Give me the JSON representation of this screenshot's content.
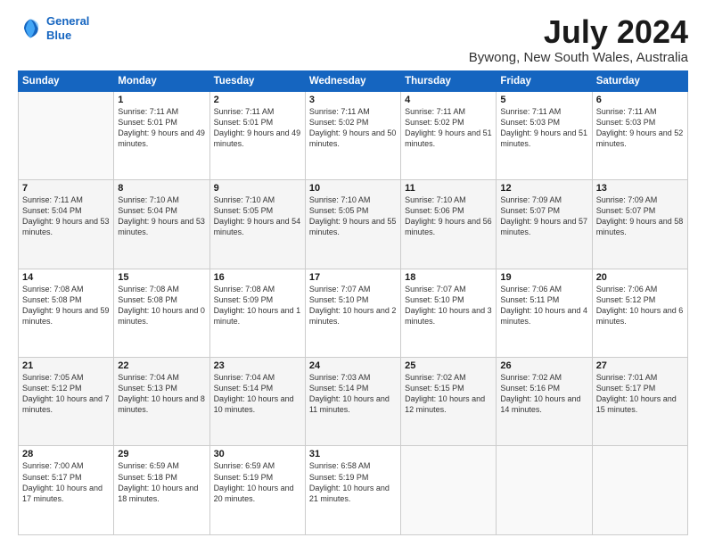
{
  "logo": {
    "line1": "General",
    "line2": "Blue"
  },
  "title": "July 2024",
  "subtitle": "Bywong, New South Wales, Australia",
  "days_of_week": [
    "Sunday",
    "Monday",
    "Tuesday",
    "Wednesday",
    "Thursday",
    "Friday",
    "Saturday"
  ],
  "weeks": [
    [
      {
        "day": "",
        "sunrise": "",
        "sunset": "",
        "daylight": ""
      },
      {
        "day": "1",
        "sunrise": "Sunrise: 7:11 AM",
        "sunset": "Sunset: 5:01 PM",
        "daylight": "Daylight: 9 hours and 49 minutes."
      },
      {
        "day": "2",
        "sunrise": "Sunrise: 7:11 AM",
        "sunset": "Sunset: 5:01 PM",
        "daylight": "Daylight: 9 hours and 49 minutes."
      },
      {
        "day": "3",
        "sunrise": "Sunrise: 7:11 AM",
        "sunset": "Sunset: 5:02 PM",
        "daylight": "Daylight: 9 hours and 50 minutes."
      },
      {
        "day": "4",
        "sunrise": "Sunrise: 7:11 AM",
        "sunset": "Sunset: 5:02 PM",
        "daylight": "Daylight: 9 hours and 51 minutes."
      },
      {
        "day": "5",
        "sunrise": "Sunrise: 7:11 AM",
        "sunset": "Sunset: 5:03 PM",
        "daylight": "Daylight: 9 hours and 51 minutes."
      },
      {
        "day": "6",
        "sunrise": "Sunrise: 7:11 AM",
        "sunset": "Sunset: 5:03 PM",
        "daylight": "Daylight: 9 hours and 52 minutes."
      }
    ],
    [
      {
        "day": "7",
        "sunrise": "Sunrise: 7:11 AM",
        "sunset": "Sunset: 5:04 PM",
        "daylight": "Daylight: 9 hours and 53 minutes."
      },
      {
        "day": "8",
        "sunrise": "Sunrise: 7:10 AM",
        "sunset": "Sunset: 5:04 PM",
        "daylight": "Daylight: 9 hours and 53 minutes."
      },
      {
        "day": "9",
        "sunrise": "Sunrise: 7:10 AM",
        "sunset": "Sunset: 5:05 PM",
        "daylight": "Daylight: 9 hours and 54 minutes."
      },
      {
        "day": "10",
        "sunrise": "Sunrise: 7:10 AM",
        "sunset": "Sunset: 5:05 PM",
        "daylight": "Daylight: 9 hours and 55 minutes."
      },
      {
        "day": "11",
        "sunrise": "Sunrise: 7:10 AM",
        "sunset": "Sunset: 5:06 PM",
        "daylight": "Daylight: 9 hours and 56 minutes."
      },
      {
        "day": "12",
        "sunrise": "Sunrise: 7:09 AM",
        "sunset": "Sunset: 5:07 PM",
        "daylight": "Daylight: 9 hours and 57 minutes."
      },
      {
        "day": "13",
        "sunrise": "Sunrise: 7:09 AM",
        "sunset": "Sunset: 5:07 PM",
        "daylight": "Daylight: 9 hours and 58 minutes."
      }
    ],
    [
      {
        "day": "14",
        "sunrise": "Sunrise: 7:08 AM",
        "sunset": "Sunset: 5:08 PM",
        "daylight": "Daylight: 9 hours and 59 minutes."
      },
      {
        "day": "15",
        "sunrise": "Sunrise: 7:08 AM",
        "sunset": "Sunset: 5:08 PM",
        "daylight": "Daylight: 10 hours and 0 minutes."
      },
      {
        "day": "16",
        "sunrise": "Sunrise: 7:08 AM",
        "sunset": "Sunset: 5:09 PM",
        "daylight": "Daylight: 10 hours and 1 minute."
      },
      {
        "day": "17",
        "sunrise": "Sunrise: 7:07 AM",
        "sunset": "Sunset: 5:10 PM",
        "daylight": "Daylight: 10 hours and 2 minutes."
      },
      {
        "day": "18",
        "sunrise": "Sunrise: 7:07 AM",
        "sunset": "Sunset: 5:10 PM",
        "daylight": "Daylight: 10 hours and 3 minutes."
      },
      {
        "day": "19",
        "sunrise": "Sunrise: 7:06 AM",
        "sunset": "Sunset: 5:11 PM",
        "daylight": "Daylight: 10 hours and 4 minutes."
      },
      {
        "day": "20",
        "sunrise": "Sunrise: 7:06 AM",
        "sunset": "Sunset: 5:12 PM",
        "daylight": "Daylight: 10 hours and 6 minutes."
      }
    ],
    [
      {
        "day": "21",
        "sunrise": "Sunrise: 7:05 AM",
        "sunset": "Sunset: 5:12 PM",
        "daylight": "Daylight: 10 hours and 7 minutes."
      },
      {
        "day": "22",
        "sunrise": "Sunrise: 7:04 AM",
        "sunset": "Sunset: 5:13 PM",
        "daylight": "Daylight: 10 hours and 8 minutes."
      },
      {
        "day": "23",
        "sunrise": "Sunrise: 7:04 AM",
        "sunset": "Sunset: 5:14 PM",
        "daylight": "Daylight: 10 hours and 10 minutes."
      },
      {
        "day": "24",
        "sunrise": "Sunrise: 7:03 AM",
        "sunset": "Sunset: 5:14 PM",
        "daylight": "Daylight: 10 hours and 11 minutes."
      },
      {
        "day": "25",
        "sunrise": "Sunrise: 7:02 AM",
        "sunset": "Sunset: 5:15 PM",
        "daylight": "Daylight: 10 hours and 12 minutes."
      },
      {
        "day": "26",
        "sunrise": "Sunrise: 7:02 AM",
        "sunset": "Sunset: 5:16 PM",
        "daylight": "Daylight: 10 hours and 14 minutes."
      },
      {
        "day": "27",
        "sunrise": "Sunrise: 7:01 AM",
        "sunset": "Sunset: 5:17 PM",
        "daylight": "Daylight: 10 hours and 15 minutes."
      }
    ],
    [
      {
        "day": "28",
        "sunrise": "Sunrise: 7:00 AM",
        "sunset": "Sunset: 5:17 PM",
        "daylight": "Daylight: 10 hours and 17 minutes."
      },
      {
        "day": "29",
        "sunrise": "Sunrise: 6:59 AM",
        "sunset": "Sunset: 5:18 PM",
        "daylight": "Daylight: 10 hours and 18 minutes."
      },
      {
        "day": "30",
        "sunrise": "Sunrise: 6:59 AM",
        "sunset": "Sunset: 5:19 PM",
        "daylight": "Daylight: 10 hours and 20 minutes."
      },
      {
        "day": "31",
        "sunrise": "Sunrise: 6:58 AM",
        "sunset": "Sunset: 5:19 PM",
        "daylight": "Daylight: 10 hours and 21 minutes."
      },
      {
        "day": "",
        "sunrise": "",
        "sunset": "",
        "daylight": ""
      },
      {
        "day": "",
        "sunrise": "",
        "sunset": "",
        "daylight": ""
      },
      {
        "day": "",
        "sunrise": "",
        "sunset": "",
        "daylight": ""
      }
    ]
  ]
}
